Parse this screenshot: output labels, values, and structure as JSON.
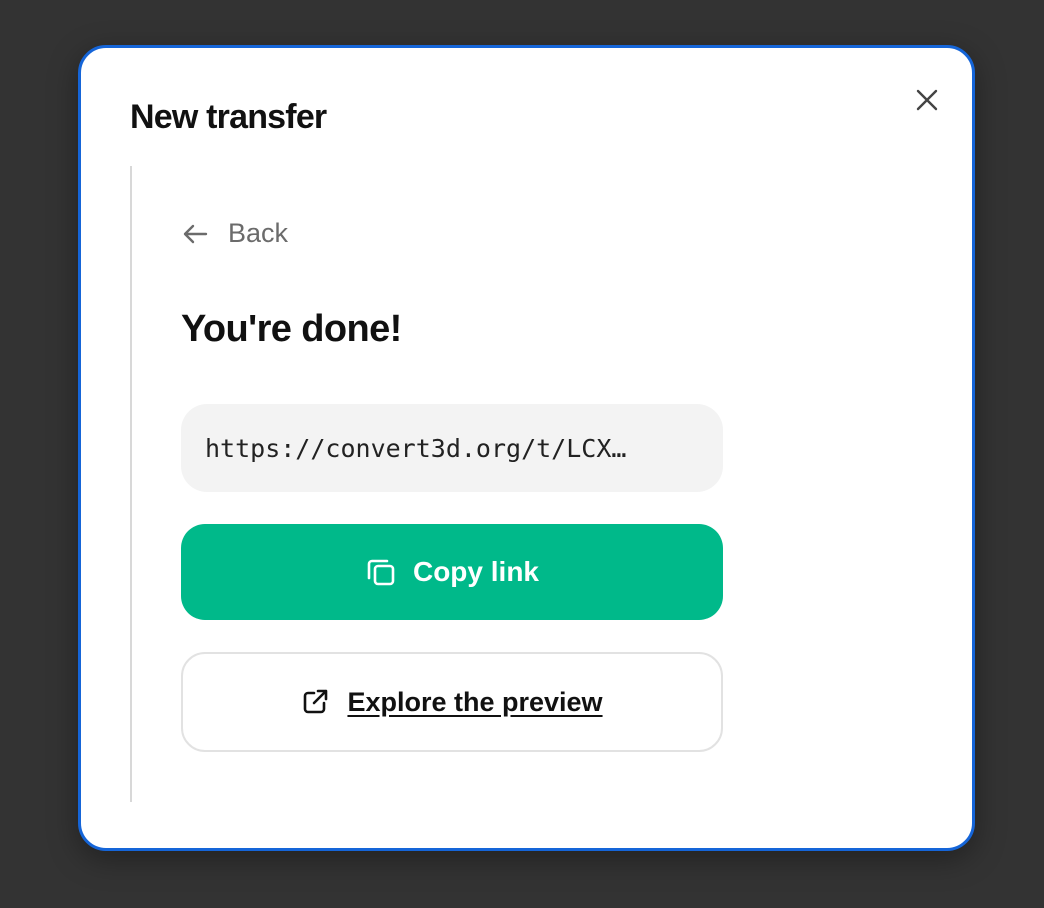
{
  "dialog": {
    "title": "New transfer",
    "close_icon": "close-icon"
  },
  "step": {
    "back_label": "Back",
    "back_icon": "arrow-left-icon",
    "heading": "You're done!",
    "share_link": "https://convert3d.org/t/LCX…",
    "copy_button": {
      "label": "Copy link",
      "icon": "copy-icon"
    },
    "preview_button": {
      "label": "Explore the preview",
      "icon": "external-link-icon"
    }
  },
  "colors": {
    "accent": "#00b98a",
    "focus_border": "#1565d8",
    "backdrop": "#333333"
  }
}
